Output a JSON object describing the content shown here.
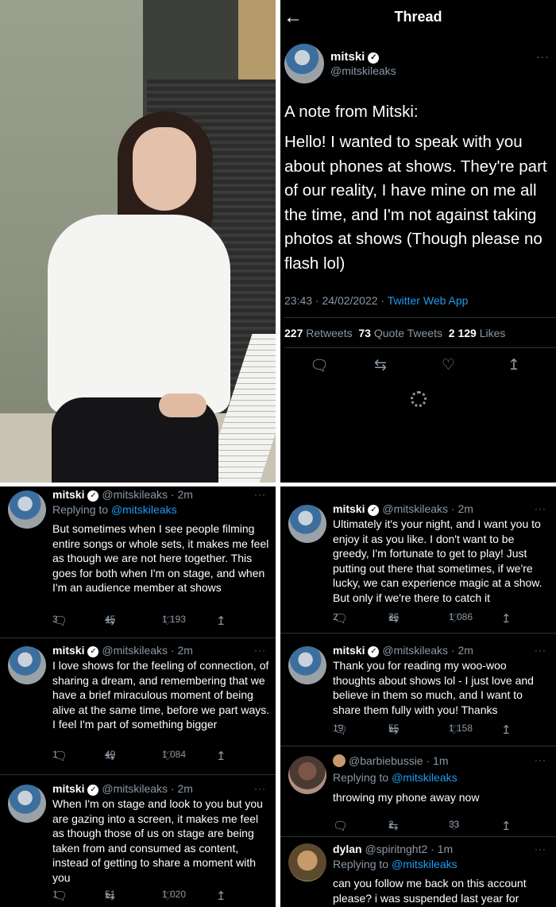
{
  "photo": {
    "alt": "woman in white blouse seated beside a piano"
  },
  "thread_panel": {
    "back_icon": "back-arrow-icon",
    "title": "Thread",
    "author_name": "mitski",
    "author_handle": "@mitskileaks",
    "more": "···",
    "text_heading": "A note from Mitski:",
    "text_body": "Hello! I wanted to speak with you about phones at shows. They're part of our reality, I have mine on me all the time, and I'm not against taking photos at shows (Though please no flash lol)",
    "time": "23:43 · 24/02/2022 · ",
    "app": "Twitter Web App",
    "retweets_count": "227",
    "retweets_label": "Retweets",
    "quotes_count": "73",
    "quotes_label": "Quote Tweets",
    "likes_count": "2 129",
    "likes_label": "Likes"
  },
  "left_tweets": [
    {
      "name": "mitski",
      "handle": "@mitskileaks · 2m",
      "replying": "Replying to ",
      "reply_to": "@mitskileaks",
      "text": "But sometimes when I see people filming entire songs or whole sets, it makes me feel as though we are not here together. This goes for both when I'm on stage, and when I'm an audience member at shows",
      "replies": "3",
      "retweets": "45",
      "likes": "1 193"
    },
    {
      "name": "mitski",
      "handle": "@mitskileaks · 2m",
      "text": "I love shows for the feeling of connection, of sharing a dream, and remembering that we have a brief miraculous moment of being alive at the same time, before we part ways. I feel I'm part of something bigger",
      "replies": "1",
      "retweets": "49",
      "likes": "1 084"
    },
    {
      "name": "mitski",
      "handle": "@mitskileaks · 2m",
      "text": "When I'm on stage and look to you but you are gazing into a screen, it makes me feel as though those of us on stage are being taken from and consumed as content, instead of getting to share a moment with you",
      "replies": "1",
      "retweets": "51",
      "likes": "1 020"
    }
  ],
  "right_tweets": [
    {
      "name": "mitski",
      "handle": "@mitskileaks · 2m",
      "text": "Ultimately it's your night, and I want you to enjoy it as you like. I don't want to be greedy, I'm fortunate to get to play! Just putting out there that sometimes, if we're lucky, we can experience magic at a show. But only if we're there to catch it",
      "replies": "2",
      "retweets": "36",
      "likes": "1 086"
    },
    {
      "name": "mitski",
      "handle": "@mitskileaks · 2m",
      "text": "Thank you for reading my woo-woo thoughts about shows lol - I just love and believe in them so much, and I want to share them fully with you! Thanks",
      "replies": "19",
      "retweets": "55",
      "likes": "1 158"
    },
    {
      "name": "",
      "handle": "@barbiebussie · 1m",
      "replying": "Replying to ",
      "reply_to": "@mitskileaks",
      "text": "throwing my phone away now",
      "replies": "",
      "retweets": "2",
      "likes": "33"
    },
    {
      "name": "dylan",
      "handle": "@spiritnght2 · 1m",
      "replying": "Replying to ",
      "reply_to": "@mitskileaks",
      "text": "can you follow me back on this account please? i was suspended last year for"
    }
  ],
  "colors": {
    "background": "#000000",
    "link": "#1d9bf0",
    "muted": "#8b98a5",
    "divider": "#2f3336"
  },
  "icons": {
    "reply": "reply-icon",
    "retweet": "retweet-icon",
    "like": "heart-icon",
    "share": "share-icon",
    "verified": "verified-badge-icon"
  }
}
